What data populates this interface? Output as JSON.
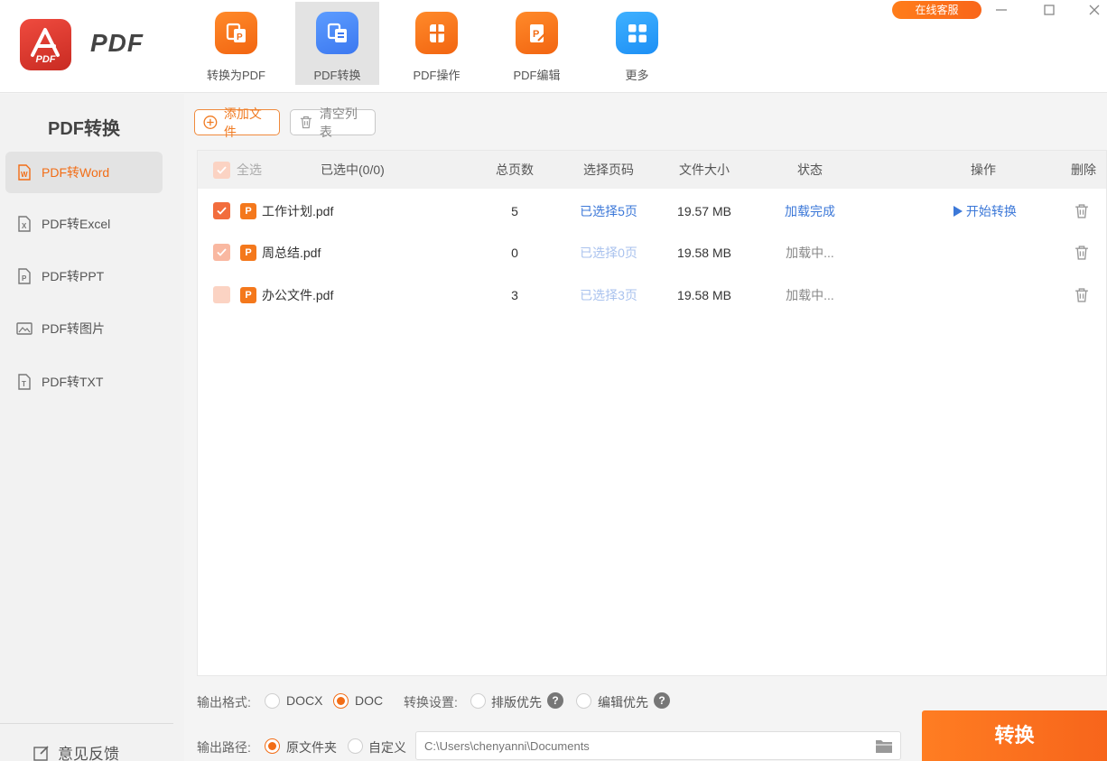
{
  "app": {
    "brand": "PDF",
    "logo_text": "PDF",
    "support_label": "在线客服",
    "accent_color": "#f26d16",
    "link_color": "#3c78d8"
  },
  "nav": {
    "items": [
      {
        "label": "转换为PDF",
        "icon": "convert-to-pdf-icon"
      },
      {
        "label": "PDF转换",
        "icon": "pdf-convert-icon",
        "active": true
      },
      {
        "label": "PDF操作",
        "icon": "pdf-operate-icon"
      },
      {
        "label": "PDF编辑",
        "icon": "pdf-edit-icon"
      },
      {
        "label": "更多",
        "icon": "more-apps-icon"
      }
    ]
  },
  "sidebar": {
    "title": "PDF转换",
    "items": [
      {
        "label": "PDF转Word",
        "active": true
      },
      {
        "label": "PDF转Excel"
      },
      {
        "label": "PDF转PPT"
      },
      {
        "label": "PDF转图片"
      },
      {
        "label": "PDF转TXT"
      }
    ],
    "feedback_label": "意见反馈"
  },
  "toolbar": {
    "add_label": "添加文件",
    "clear_label": "清空列表"
  },
  "table": {
    "headers": {
      "select_all": "全选",
      "selected": "已选中(0/0)",
      "pages": "总页数",
      "page_select": "选择页码",
      "size": "文件大小",
      "status": "状态",
      "action": "操作",
      "delete": "删除"
    },
    "rows": [
      {
        "name": "工作计划.pdf",
        "pages": "5",
        "selection": "已选择5页",
        "size": "19.57 MB",
        "status": "加载完成",
        "action": "开始转换"
      },
      {
        "name": "周总结.pdf",
        "pages": "0",
        "selection": "已选择0页",
        "size": "19.58 MB",
        "status": "加载中...",
        "action": ""
      },
      {
        "name": "办公文件.pdf",
        "pages": "3",
        "selection": "已选择3页",
        "size": "19.58 MB",
        "status": "加载中...",
        "action": ""
      }
    ]
  },
  "settings": {
    "format_label": "输出格式:",
    "format_docx": "DOCX",
    "format_doc": "DOC",
    "format_selected": "DOC",
    "convert_settings_label": "转换设置:",
    "layout_priority": "排版优先",
    "edit_priority": "编辑优先",
    "path_label": "输出路径:",
    "path_original": "原文件夹",
    "path_custom": "自定义",
    "path_selected": "原文件夹",
    "path_placeholder": "C:\\Users\\chenyanni\\Documents"
  },
  "convert_button": "转换"
}
